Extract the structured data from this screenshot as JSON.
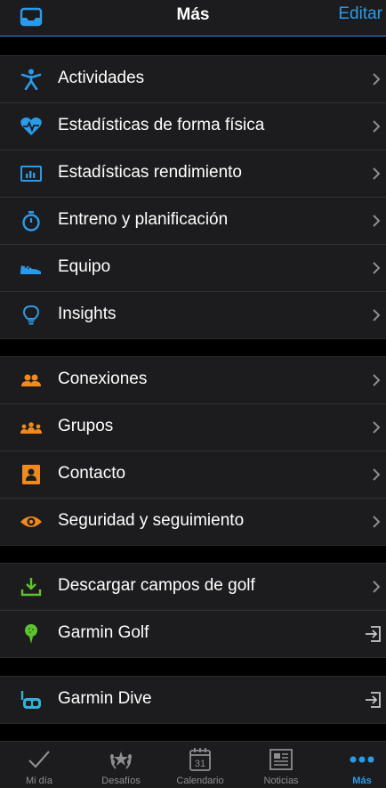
{
  "header": {
    "title": "Más",
    "edit_label": "Editar"
  },
  "sections": [
    {
      "items": [
        {
          "label": "Actividades",
          "icon": "running-figure-icon"
        },
        {
          "label": "Estadísticas de forma física",
          "icon": "heart-rate-icon"
        },
        {
          "label": "Estadísticas rendimiento",
          "icon": "performance-chart-icon"
        },
        {
          "label": "Entreno y planificación",
          "icon": "stopwatch-icon"
        },
        {
          "label": "Equipo",
          "icon": "shoe-icon"
        },
        {
          "label": "Insights",
          "icon": "lightbulb-icon"
        }
      ]
    },
    {
      "items": [
        {
          "label": "Conexiones",
          "icon": "connections-icon"
        },
        {
          "label": "Grupos",
          "icon": "groups-icon"
        },
        {
          "label": "Contacto",
          "icon": "contact-card-icon"
        },
        {
          "label": "Seguridad y seguimiento",
          "icon": "eye-icon"
        }
      ]
    },
    {
      "items": [
        {
          "label": "Descargar campos de golf",
          "icon": "download-icon"
        },
        {
          "label": "Garmin Golf",
          "icon": "golf-ball-icon"
        }
      ]
    },
    {
      "items": [
        {
          "label": "Garmin Dive",
          "icon": "dive-mask-icon"
        }
      ]
    }
  ],
  "tabs": [
    {
      "label": "Mi día",
      "icon": "checkmark-icon"
    },
    {
      "label": "Desafíos",
      "icon": "laurel-icon"
    },
    {
      "label": "Calendario",
      "icon": "calendar-icon",
      "day": "31"
    },
    {
      "label": "Noticias",
      "icon": "newspaper-icon"
    },
    {
      "label": "Más",
      "icon": "more-dots-icon",
      "active": true
    }
  ],
  "colors": {
    "blue": "#2a9bea",
    "orange": "#f0891e",
    "green": "#5fc230",
    "teal": "#2fb3d8"
  }
}
